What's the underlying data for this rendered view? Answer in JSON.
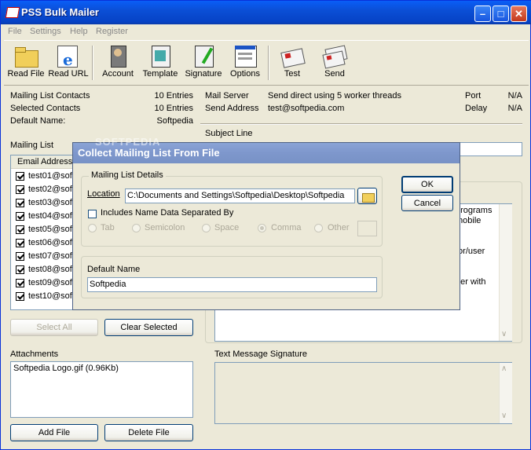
{
  "window": {
    "title": "PSS Bulk Mailer"
  },
  "menu": [
    "File",
    "Settings",
    "Help",
    "Register"
  ],
  "toolbar": [
    "Read File",
    "Read URL",
    "Account",
    "Template",
    "Signature",
    "Options",
    "Test",
    "Send"
  ],
  "info_left": [
    {
      "label": "Mailing List Contacts",
      "value": "10 Entries"
    },
    {
      "label": "Selected Contacts",
      "value": "10 Entries"
    },
    {
      "label": "Default Name:",
      "value": "Softpedia"
    }
  ],
  "info_right": {
    "mail_server_label": "Mail Server",
    "mail_server_value": "Send direct using 5 worker threads",
    "send_address_label": "Send Address",
    "send_address_value": "test@softpedia.com",
    "port_label": "Port",
    "port_value": "N/A",
    "delay_label": "Delay",
    "delay_value": "N/A"
  },
  "subject_label": "Subject Line",
  "mailing_list": {
    "label": "Mailing List",
    "column": "Email Address",
    "items": [
      "test01@soft",
      "test02@soft",
      "test03@soft",
      "test04@soft",
      "test05@soft",
      "test06@soft",
      "test07@soft",
      "test08@soft",
      "test09@soft",
      "test10@soft"
    ]
  },
  "buttons": {
    "select_all": "Select All",
    "clear_selected": "Clear Selected",
    "add_file": "Add File",
    "delete_file": "Delete File"
  },
  "attachments": {
    "label": "Attachments",
    "items": [
      "Softpedia Logo.gif (0.96Kb)"
    ]
  },
  "message_fragments": [
    "programs",
    "mobile",
    "tor/user",
    "her with"
  ],
  "signature_label": "Text Message Signature",
  "watermark": "SOFTPEDIA",
  "dialog": {
    "title": "Collect Mailing List From File",
    "group_label": "Mailing List Details",
    "location_label": "Location",
    "location_value": "C:\\Documents and Settings\\Softpedia\\Desktop\\Softpedia",
    "includes_label": "Includes Name Data Separated By",
    "separators": [
      "Tab",
      "Semicolon",
      "Space",
      "Comma",
      "Other"
    ],
    "selected_separator": "Comma",
    "default_name_label": "Default Name",
    "default_name_value": "Softpedia",
    "ok": "OK",
    "cancel": "Cancel"
  },
  "colors": {
    "titlebar": "#0b4fd6",
    "dialog_title": "#7e97cc",
    "face": "#ece9d8",
    "field_border": "#7f9db9"
  }
}
